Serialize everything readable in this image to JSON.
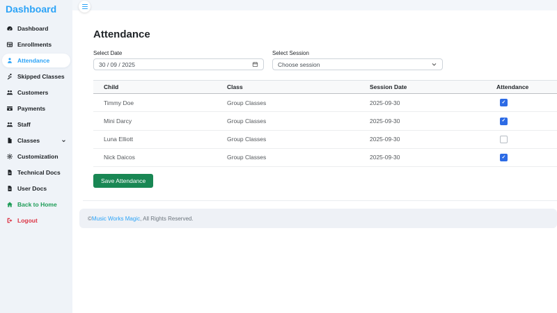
{
  "colors": {
    "accent_blue": "#2ba3f7",
    "checkbox_blue": "#2d6be5",
    "button_green": "#198754",
    "home_green": "#1f9d58",
    "logout_red": "#dc3545",
    "sidebar_bg": "#eff3f8",
    "table_header_bg": "#f8f9fa"
  },
  "topbar": {
    "menu_icon": "hamburger-icon"
  },
  "sidebar": {
    "title": "Dashboard",
    "items": [
      {
        "label": "Dashboard",
        "icon": "gauge-icon"
      },
      {
        "label": "Enrollments",
        "icon": "table-icon"
      },
      {
        "label": "Attendance",
        "icon": "person-icon",
        "active": true
      },
      {
        "label": "Skipped Classes",
        "icon": "person-running-icon"
      },
      {
        "label": "Customers",
        "icon": "users-icon"
      },
      {
        "label": "Payments",
        "icon": "money-icon"
      },
      {
        "label": "Staff",
        "icon": "users-icon"
      },
      {
        "label": "Classes",
        "icon": "file-icon",
        "expandable": true
      },
      {
        "label": "Customization",
        "icon": "gear-icon"
      },
      {
        "label": "Technical Docs",
        "icon": "document-icon"
      },
      {
        "label": "User Docs",
        "icon": "document-icon"
      },
      {
        "label": "Back to Home",
        "icon": "home-icon",
        "color": "#1f9d58"
      },
      {
        "label": "Logout",
        "icon": "logout-icon",
        "color": "#dc3545"
      }
    ]
  },
  "main": {
    "title": "Attendance",
    "filters": {
      "date": {
        "label": "Select Date",
        "value": "30 / 09 / 2025"
      },
      "session": {
        "label": "Select Session",
        "value": "Choose session"
      }
    },
    "table": {
      "headers": [
        "Child",
        "Class",
        "Session Date",
        "Attendance"
      ],
      "rows": [
        {
          "child": "Timmy Doe",
          "class": "Group Classes",
          "session_date": "2025-09-30",
          "attendance": "checked"
        },
        {
          "child": "Mini Darcy",
          "class": "Group Classes",
          "session_date": "2025-09-30",
          "attendance": "checked"
        },
        {
          "child": "Luna Elliott",
          "class": "Group Classes",
          "session_date": "2025-09-30",
          "attendance": "unchecked"
        },
        {
          "child": "Nick Daicos",
          "class": "Group Classes",
          "session_date": "2025-09-30",
          "attendance": "checked"
        }
      ]
    },
    "save_button_label": "Save Attendance"
  },
  "footer": {
    "prefix": "© ",
    "link_text": "Music Works Magic",
    "suffix": ", All Rights Reserved."
  }
}
